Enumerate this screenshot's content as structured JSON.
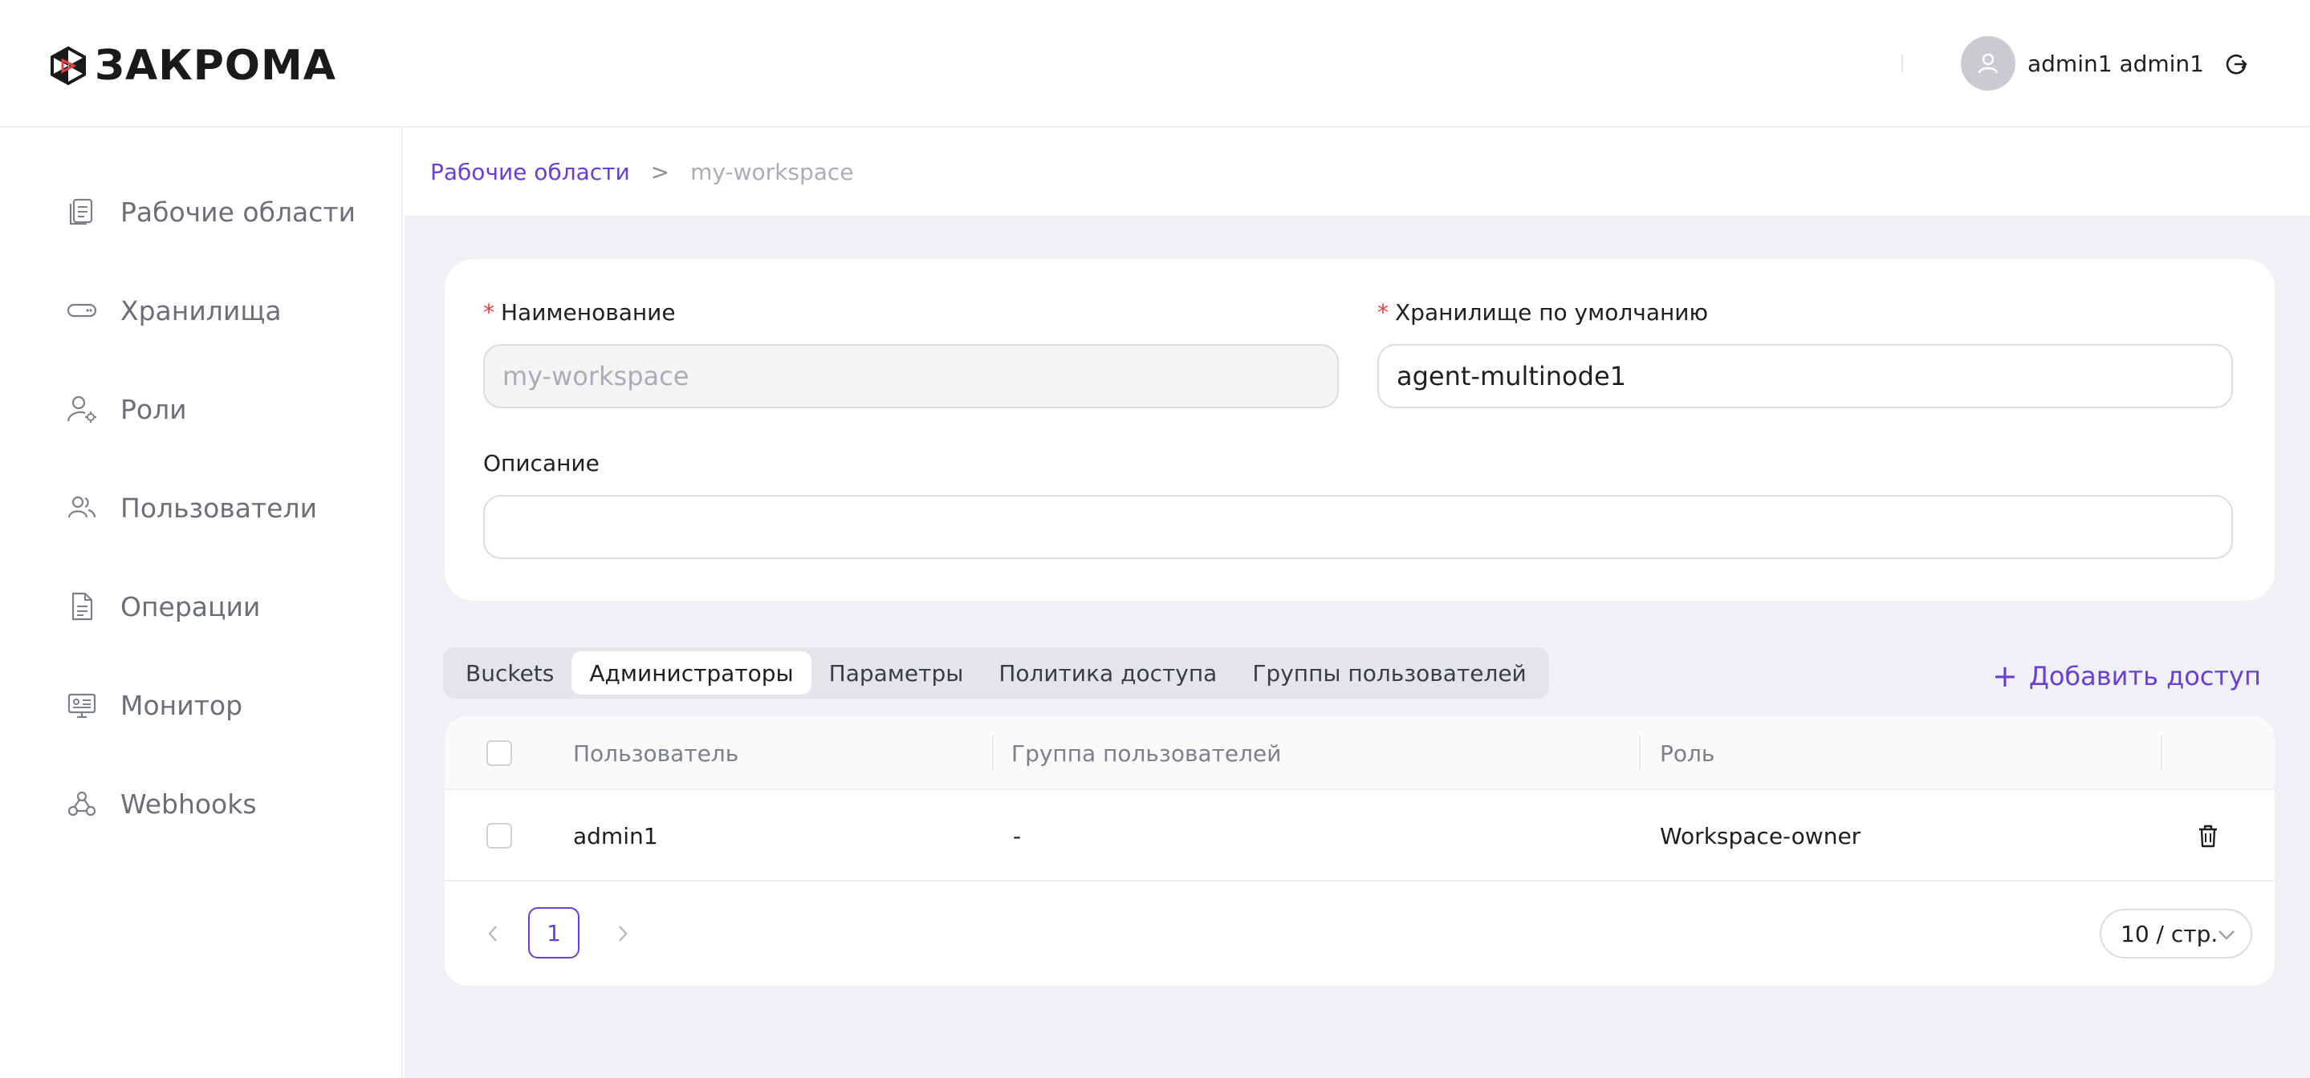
{
  "header": {
    "logo_text": "ЗАКРОМА",
    "user_name": "admin1 admin1",
    "icons": {
      "avatar": "user-icon",
      "logout": "logout-icon"
    }
  },
  "sidebar": {
    "items": [
      {
        "label": "Рабочие области",
        "icon": "workspaces-icon"
      },
      {
        "label": "Хранилища",
        "icon": "storage-icon"
      },
      {
        "label": "Роли",
        "icon": "role-icon"
      },
      {
        "label": "Пользователи",
        "icon": "users-icon"
      },
      {
        "label": "Операции",
        "icon": "operations-icon"
      },
      {
        "label": "Монитор",
        "icon": "monitor-icon"
      },
      {
        "label": "Webhooks",
        "icon": "webhooks-icon"
      }
    ]
  },
  "breadcrumb": {
    "parent": "Рабочие области",
    "separator": ">",
    "current": "my-workspace"
  },
  "form": {
    "name_label": "Наименование",
    "name_value": "my-workspace",
    "storage_label": "Хранилище по умолчанию",
    "storage_value": "agent-multinode1",
    "description_label": "Описание",
    "description_value": "",
    "required_mark": "*"
  },
  "tabs": [
    {
      "label": "Buckets",
      "active": false
    },
    {
      "label": "Администраторы",
      "active": true
    },
    {
      "label": "Параметры",
      "active": false
    },
    {
      "label": "Политика доступа",
      "active": false
    },
    {
      "label": "Группы пользователей",
      "active": false
    }
  ],
  "add_access": {
    "plus": "+",
    "label": "Добавить доступ"
  },
  "table": {
    "columns": [
      "Пользователь",
      "Группа пользователей",
      "Роль"
    ],
    "rows": [
      {
        "user": "admin1",
        "group": "-",
        "role": "Workspace-owner"
      }
    ]
  },
  "pagination": {
    "current_page": "1",
    "page_size": "10 / стр."
  },
  "colors": {
    "accent": "#6a3fd6",
    "required": "#e0433f",
    "background": "#eff1f4"
  }
}
